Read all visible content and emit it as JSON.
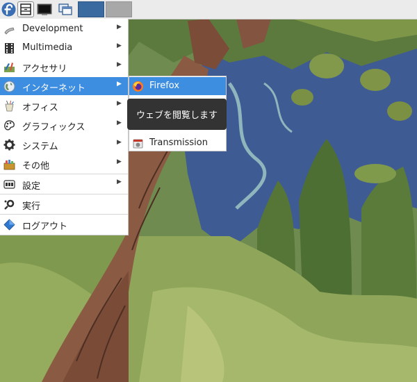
{
  "panel": {
    "workspaces": [
      "1",
      "2"
    ]
  },
  "menu": {
    "items": [
      {
        "label": "Development",
        "icon": "development-icon",
        "submenu": true
      },
      {
        "label": "Multimedia",
        "icon": "multimedia-icon",
        "submenu": true
      },
      {
        "label": "アクセサリ",
        "icon": "accessories-icon",
        "submenu": true
      },
      {
        "label": "インターネット",
        "icon": "internet-icon",
        "submenu": true,
        "active": true
      },
      {
        "label": "オフィス",
        "icon": "office-icon",
        "submenu": true
      },
      {
        "label": "グラフィックス",
        "icon": "graphics-icon",
        "submenu": true
      },
      {
        "label": "システム",
        "icon": "system-icon",
        "submenu": true
      },
      {
        "label": "その他",
        "icon": "other-icon",
        "submenu": true
      },
      {
        "label": "設定",
        "icon": "settings-icon",
        "submenu": true
      },
      {
        "label": "実行",
        "icon": "run-icon",
        "submenu": false
      },
      {
        "label": "ログアウト",
        "icon": "logout-icon",
        "submenu": false
      }
    ]
  },
  "submenu": {
    "items": [
      {
        "label": "Firefox",
        "icon": "firefox-icon",
        "active": true
      },
      {
        "label": "Transmission",
        "icon": "transmission-icon",
        "active": false
      }
    ]
  },
  "tooltip": {
    "text": "ウェブを閲覧します"
  },
  "colors": {
    "highlight": "#3d8ee0",
    "tooltip_bg": "#333333",
    "panel_bg": "#ebebeb"
  }
}
